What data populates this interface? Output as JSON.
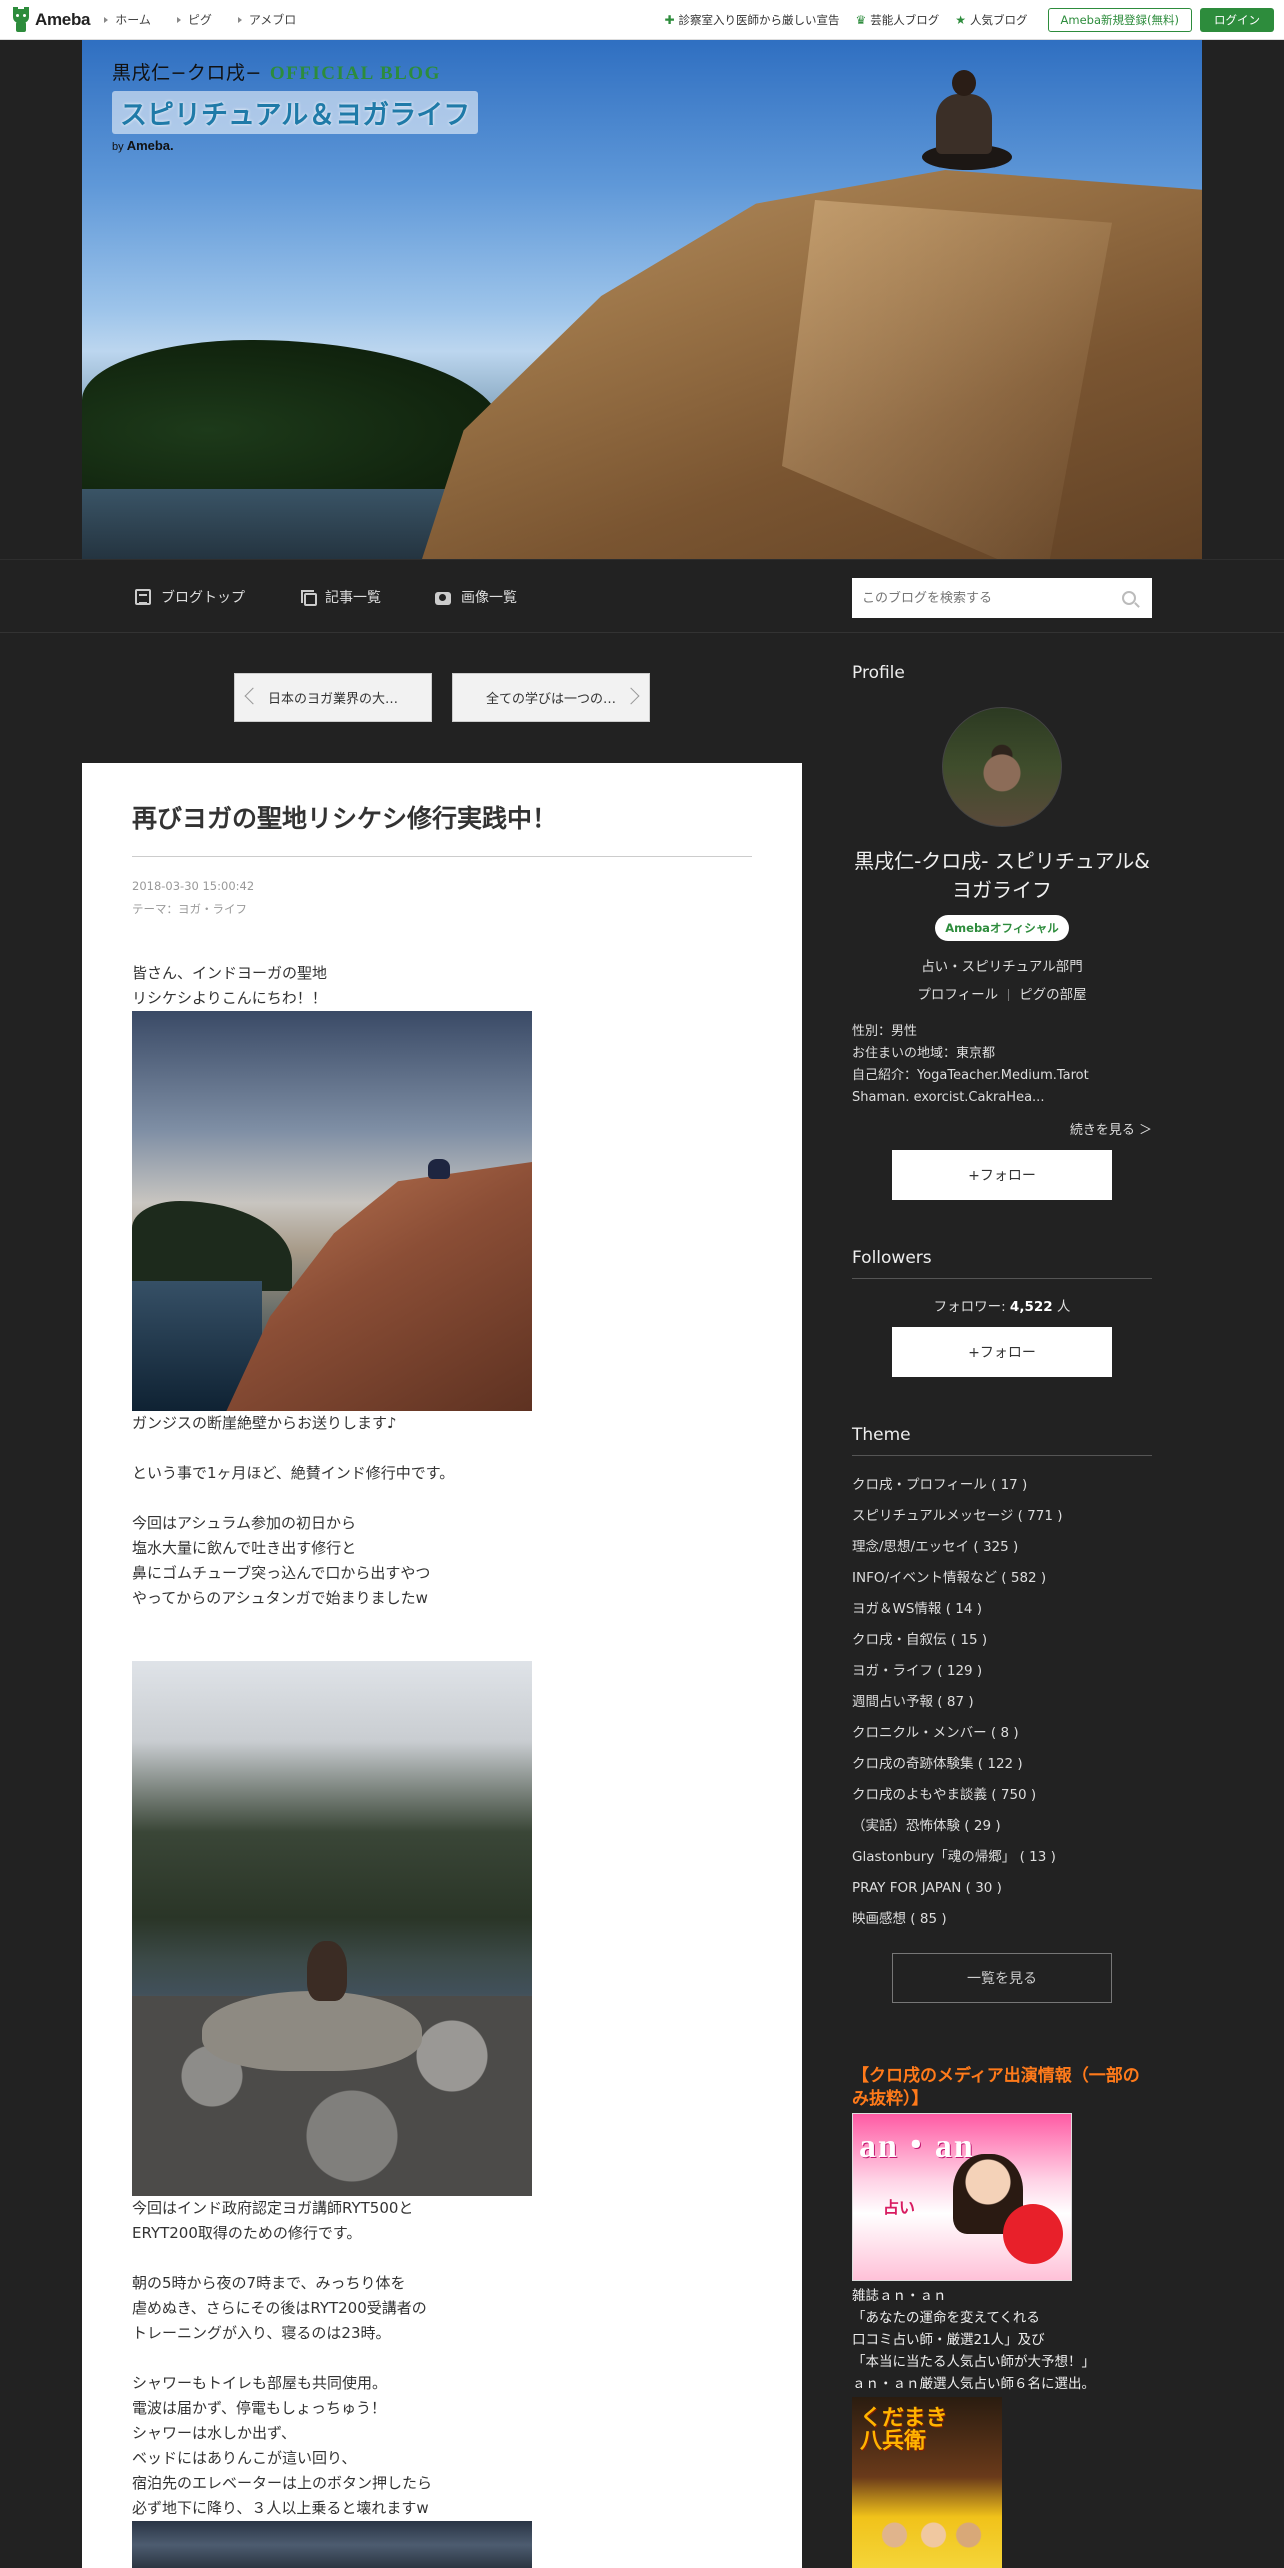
{
  "topbar": {
    "logo_text": "Ameba",
    "nav": [
      "ホーム",
      "ピグ",
      "アメブロ"
    ],
    "promos": [
      {
        "icon": "plus-icon",
        "label": "診察室入り医師から厳しい宣告"
      },
      {
        "icon": "crown-icon",
        "label": "芸能人ブログ"
      },
      {
        "icon": "star-icon",
        "label": "人気ブログ"
      }
    ],
    "register_label": "Ameba新規登録(無料)",
    "login_label": "ログイン",
    "accent_color": "#2d8c3c"
  },
  "header": {
    "title_line1": "黒戌仁−クロ戌−",
    "title_official": "OFFICIAL BLOG",
    "title_line2": "スピリチュアル＆ヨガライフ",
    "by_prefix": "by",
    "by_brand": "Ameba."
  },
  "blognav": {
    "items": [
      {
        "icon": "document-icon",
        "label": "ブログトップ"
      },
      {
        "icon": "list-icon",
        "label": "記事一覧"
      },
      {
        "icon": "camera-icon",
        "label": "画像一覧"
      }
    ],
    "search_placeholder": "このブログを検索する"
  },
  "pager": {
    "prev": "日本のヨガ業界の大…",
    "next": "全ての学びは一つの…"
  },
  "article": {
    "title": "再びヨガの聖地リシケシ修行実践中！",
    "date": "2018-03-30 15:00:42",
    "theme_label": "テーマ：",
    "theme_value": "ヨガ・ライフ",
    "para1": "皆さん、インドヨーガの聖地\nリシケシよりこんにちわ！！",
    "para2": "ガンジスの断崖絶壁からお送りします♪",
    "para3": "という事で1ヶ月ほど、絶賛インド修行中です。",
    "para4": "今回はアシュラム参加の初日から\n塩水大量に飲んで吐き出す修行と\n鼻にゴムチューブ突っ込んで口から出すやつ\nやってからのアシュタンガで始まりましたw",
    "para5": "今回はインド政府認定ヨガ講師RYT500と\nERYT200取得のための修行です。",
    "para6": "朝の5時から夜の7時まで、みっちり体を\n虐めぬき、さらにその後はRYT200受講者の\nトレーニングが入り、寝るのは23時。",
    "para7": "シャワーもトイレも部屋も共同使用。\n電波は届かず、停電もしょっちゅう！\nシャワーは水しか出ず、\nベッドにはありんこが這い回り、\n宿泊先のエレベーターは上のボタン押したら\n必ず地下に降り、３人以上乗ると壊れますw"
  },
  "sidebar": {
    "profile_heading": "Profile",
    "name": "黒戌仁-クロ戌- スピリチュアル&ヨガライフ",
    "official_badge": "Amebaオフィシャル",
    "category": "占い・スピリチュアル部門",
    "link_profile": "プロフィール",
    "link_room": "ピグの部屋",
    "meta": "性別：男性\nお住まいの地域：東京都\n自己紹介：YogaTeacher.Medium.Tarot\nShaman. exorcist.CakraHea...",
    "more": "続きを見る ＞",
    "follow_label": "+フォロー",
    "followers_heading": "Followers",
    "followers_prefix": "フォロワー: ",
    "followers_count": "4,522",
    "followers_suffix": " 人",
    "theme_heading": "Theme",
    "themes": [
      "クロ戌・プロフィール ( 17 )",
      "スピリチュアルメッセージ ( 771 )",
      "理念/思想/エッセイ ( 325 )",
      "INFO/イベント情報など ( 582 )",
      "ヨガ＆WS情報 ( 14 )",
      "クロ戌・自叙伝 ( 15 )",
      "ヨガ・ライフ ( 129 )",
      "週間占い予報 ( 87 )",
      "クロニクル・メンバー ( 8 )",
      "クロ戌の奇跡体験集 ( 122 )",
      "クロ戌のよもやま談義 ( 750 )",
      "（実話）恐怖体験 ( 29 )",
      "Glastonbury「魂の帰郷」 ( 13 )",
      "PRAY FOR JAPAN ( 30 )",
      "映画感想 ( 85 )"
    ],
    "theme_all": "一覧を見る",
    "media_heading": "【クロ戌のメディア出演情報（一部のみ抜粋）】",
    "mag1_title": "an・an",
    "mag1_text": "占い",
    "mag_caption": "雑誌ａｎ・ａｎ\n「あなたの運命を変えてくれる\n口コミ占い師・厳選21人」及び\n「本当に当たる人気占い師が大予想！」\nａｎ・ａｎ厳選人気占い師６名に選出。",
    "mag2_title": "くだまき\n八兵衛"
  }
}
